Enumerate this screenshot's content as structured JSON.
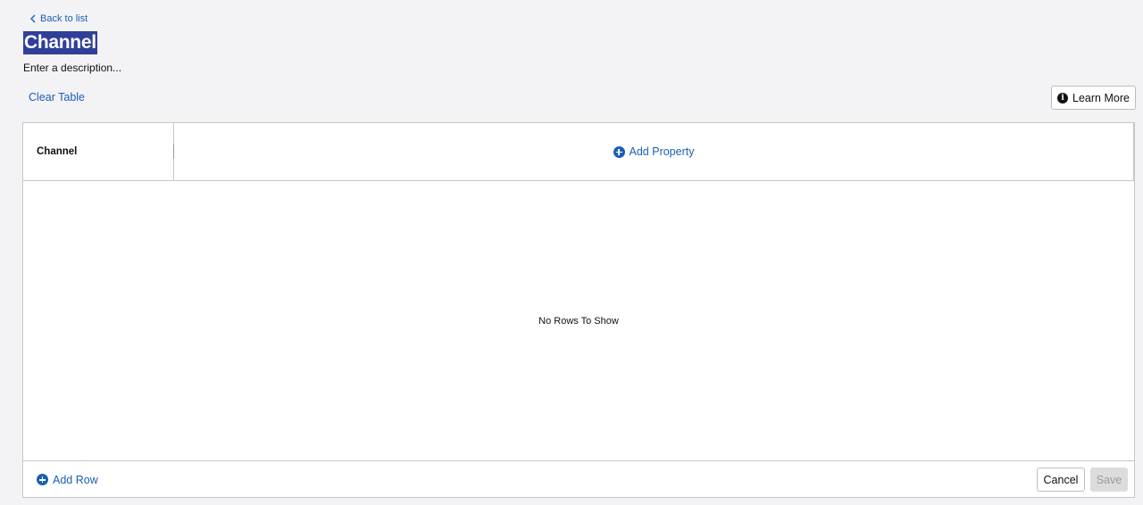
{
  "nav": {
    "back_label": "Back to list"
  },
  "header": {
    "title": "Channel",
    "description": "Enter a description..."
  },
  "toolbar": {
    "clear_table_label": "Clear Table",
    "learn_more_label": "Learn More"
  },
  "table": {
    "columns": [
      "Channel"
    ],
    "add_property_label": "Add Property",
    "empty_message": "No Rows To Show"
  },
  "footer": {
    "add_row_label": "Add Row",
    "cancel_label": "Cancel",
    "save_label": "Save"
  },
  "colors": {
    "accent": "#1a5fb4",
    "title_selection": "#2f3f9a",
    "background": "#f3f3f5"
  }
}
